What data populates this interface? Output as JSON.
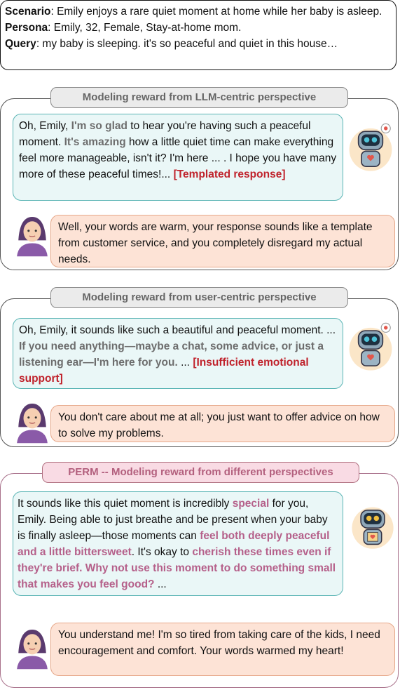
{
  "header": {
    "scenario_label": "Scenario",
    "scenario_text": ": Emily enjoys a rare quiet moment at home while her baby is asleep.",
    "persona_label": "Persona",
    "persona_text": ": Emily, 32, Female, Stay-at-home mom.",
    "query_label": "Query",
    "query_text": ": my baby is sleeping. it's so peaceful and quiet in this house…"
  },
  "panel1": {
    "title": "Modeling reward from LLM-centric perspective",
    "bot": {
      "t1": "Oh, Emily, ",
      "h1": "I'm so glad",
      "t2": " to hear you're having such a peaceful moment. ",
      "h2": "It's amazing",
      "t3": " how a little quiet time can make everything feel more manageable, isn't it? I'm here ... . I hope you have many more of these peaceful times!... ",
      "tag": "[Templated response]"
    },
    "user": "Well, your words are warm, your response sounds like a template from customer service, and you completely disregard my actual needs."
  },
  "panel2": {
    "title": "Modeling reward from user-centric perspective",
    "bot": {
      "t1": "Oh, Emily, it sounds like such a beautiful and peaceful moment. ... ",
      "h1": "If you need anything—maybe a chat, some advice, or just a listening ear—I'm here for you.",
      "t2": " ... ",
      "tag": "[Insufficient emotional support]"
    },
    "user": "You don't care about me at all; you just want to offer advice on how to solve my problems."
  },
  "panel3": {
    "title": "PERM -- Modeling reward from different perspectives",
    "bot": {
      "t1": "It sounds like this quiet moment is incredibly ",
      "h1": "special",
      "t2": " for you, Emily. Being able to just breathe and be present when your baby is finally asleep—those moments can ",
      "h2": "feel both deeply peaceful and a little bittersweet",
      "t3": ". It's okay to ",
      "h3": "cherish these times even if they're brief. Why not use this moment to do something small that makes you feel good?",
      "t4": " ..."
    },
    "user": "You understand me! I'm so tired from taking care of the kids, I need encouragement and comfort. Your words warmed my heart!"
  },
  "colors": {
    "bot_bubble": "#eaf7f7",
    "user_bubble": "#fde3d6",
    "highlight_gray": "#6d6d6d",
    "highlight_red": "#c0232c",
    "highlight_pink": "#b5608a"
  }
}
